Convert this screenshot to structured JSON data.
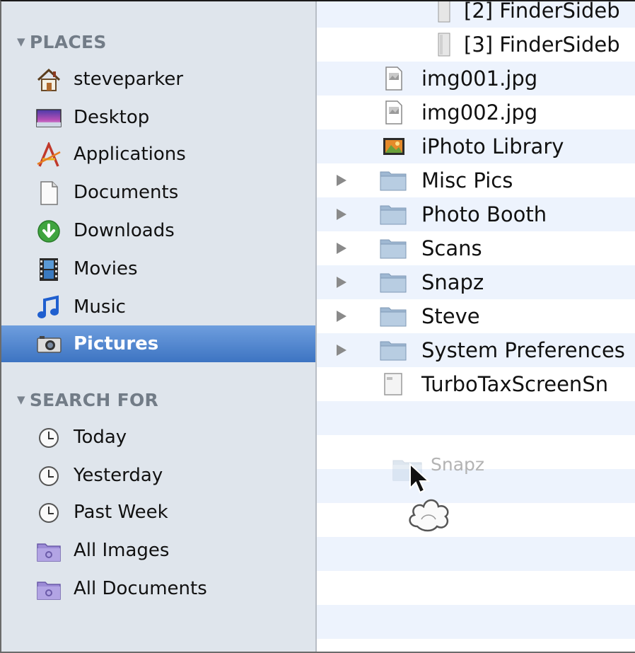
{
  "sidebar": {
    "places_header": "PLACES",
    "search_header": "SEARCH FOR",
    "places": [
      {
        "label": "steveparker",
        "icon": "home-icon"
      },
      {
        "label": "Desktop",
        "icon": "desktop-icon"
      },
      {
        "label": "Applications",
        "icon": "applications-icon"
      },
      {
        "label": "Documents",
        "icon": "documents-icon"
      },
      {
        "label": "Downloads",
        "icon": "downloads-icon"
      },
      {
        "label": "Movies",
        "icon": "movies-icon"
      },
      {
        "label": "Music",
        "icon": "music-icon"
      },
      {
        "label": "Pictures",
        "icon": "pictures-icon",
        "selected": true
      }
    ],
    "search": [
      {
        "label": "Today",
        "icon": "clock-icon"
      },
      {
        "label": "Yesterday",
        "icon": "clock-icon"
      },
      {
        "label": "Past Week",
        "icon": "clock-icon"
      },
      {
        "label": "All Images",
        "icon": "smart-folder-icon"
      },
      {
        "label": "All Documents",
        "icon": "smart-folder-icon"
      }
    ]
  },
  "files": [
    {
      "label": "[2] FinderSideb",
      "icon": "file-icon",
      "indent": true
    },
    {
      "label": "[3] FinderSideb",
      "icon": "file-icon",
      "indent": true
    },
    {
      "label": "img001.jpg",
      "icon": "image-file-icon"
    },
    {
      "label": "img002.jpg",
      "icon": "image-file-icon"
    },
    {
      "label": "iPhoto Library",
      "icon": "iphoto-icon"
    },
    {
      "label": "Misc Pics",
      "icon": "folder-icon"
    },
    {
      "label": "Photo Booth",
      "icon": "folder-icon"
    },
    {
      "label": "Scans",
      "icon": "folder-icon"
    },
    {
      "label": "Snapz",
      "icon": "folder-icon"
    },
    {
      "label": "Steve",
      "icon": "folder-icon"
    },
    {
      "label": "System Preferences",
      "icon": "folder-icon"
    },
    {
      "label": "TurboTaxScreenSn",
      "icon": "document-icon"
    }
  ],
  "drag": {
    "label": "Snapz",
    "icon": "folder-icon"
  },
  "colors": {
    "selection": "#3d74c2",
    "sidebar": "#dfe5ec",
    "stripe": "#edf3fd"
  }
}
